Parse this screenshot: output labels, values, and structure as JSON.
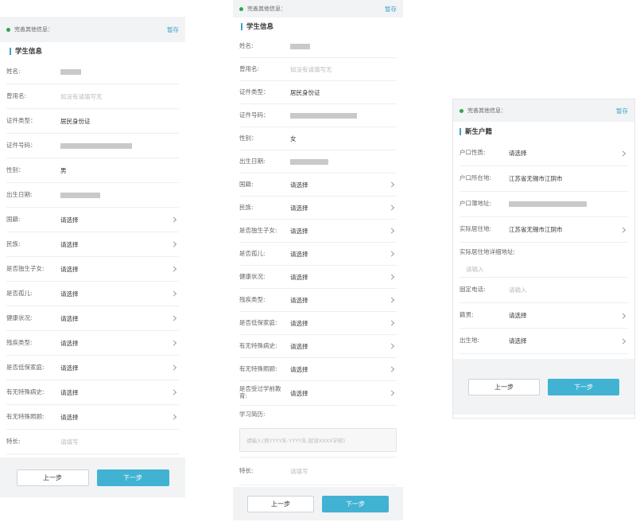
{
  "common": {
    "header": "完善其他信息：",
    "save": "暂存",
    "prev": "上一步",
    "next": "下一步",
    "select": "请选择",
    "fill": "请填写",
    "input": "请输入"
  },
  "student": {
    "section": "学生信息",
    "name": "姓名:",
    "former_name": "曾用名:",
    "former_name_placeholder": "如没有请填写无",
    "id_type": "证件类型：",
    "id_type_value": "居民身份证",
    "id_number": "证件号码：",
    "gender": "性别：",
    "gender_value_1": "男",
    "gender_value_2": "女",
    "birthdate": "出生日期:",
    "nationality": "国籍:",
    "ethnicity": "民族:",
    "only_child": "是否独生子女:",
    "orphan": "是否孤儿:",
    "health": "健康状况:",
    "disability": "残疾类型:",
    "low_income": "是否低保家庭:",
    "medical_history": "有无特殊病史:",
    "special_care": "有无特殊照顾:",
    "preschool": "是否受过学前教育:",
    "study_history": "学习简历:",
    "study_history_placeholder": "请输入(例YYYY年-YYYY年,就读XXXX学校)",
    "specialty": "特长:"
  },
  "household": {
    "section": "新生户籍",
    "type": "户口性质:",
    "location": "户口所在地:",
    "location_value": "江苏省无锡市江阴市",
    "address": "户口簿地址:",
    "residence": "实际居住地:",
    "residence_value": "江苏省无锡市江阴市",
    "residence_detail": "实际居住地详细地址:",
    "phone": "固定电话:",
    "native": "籍贯:",
    "birthplace": "出生地:"
  },
  "colors": {
    "accent": "#3aa3c9",
    "button_primary": "#42b2d3",
    "status_dot": "#2ea44f"
  }
}
